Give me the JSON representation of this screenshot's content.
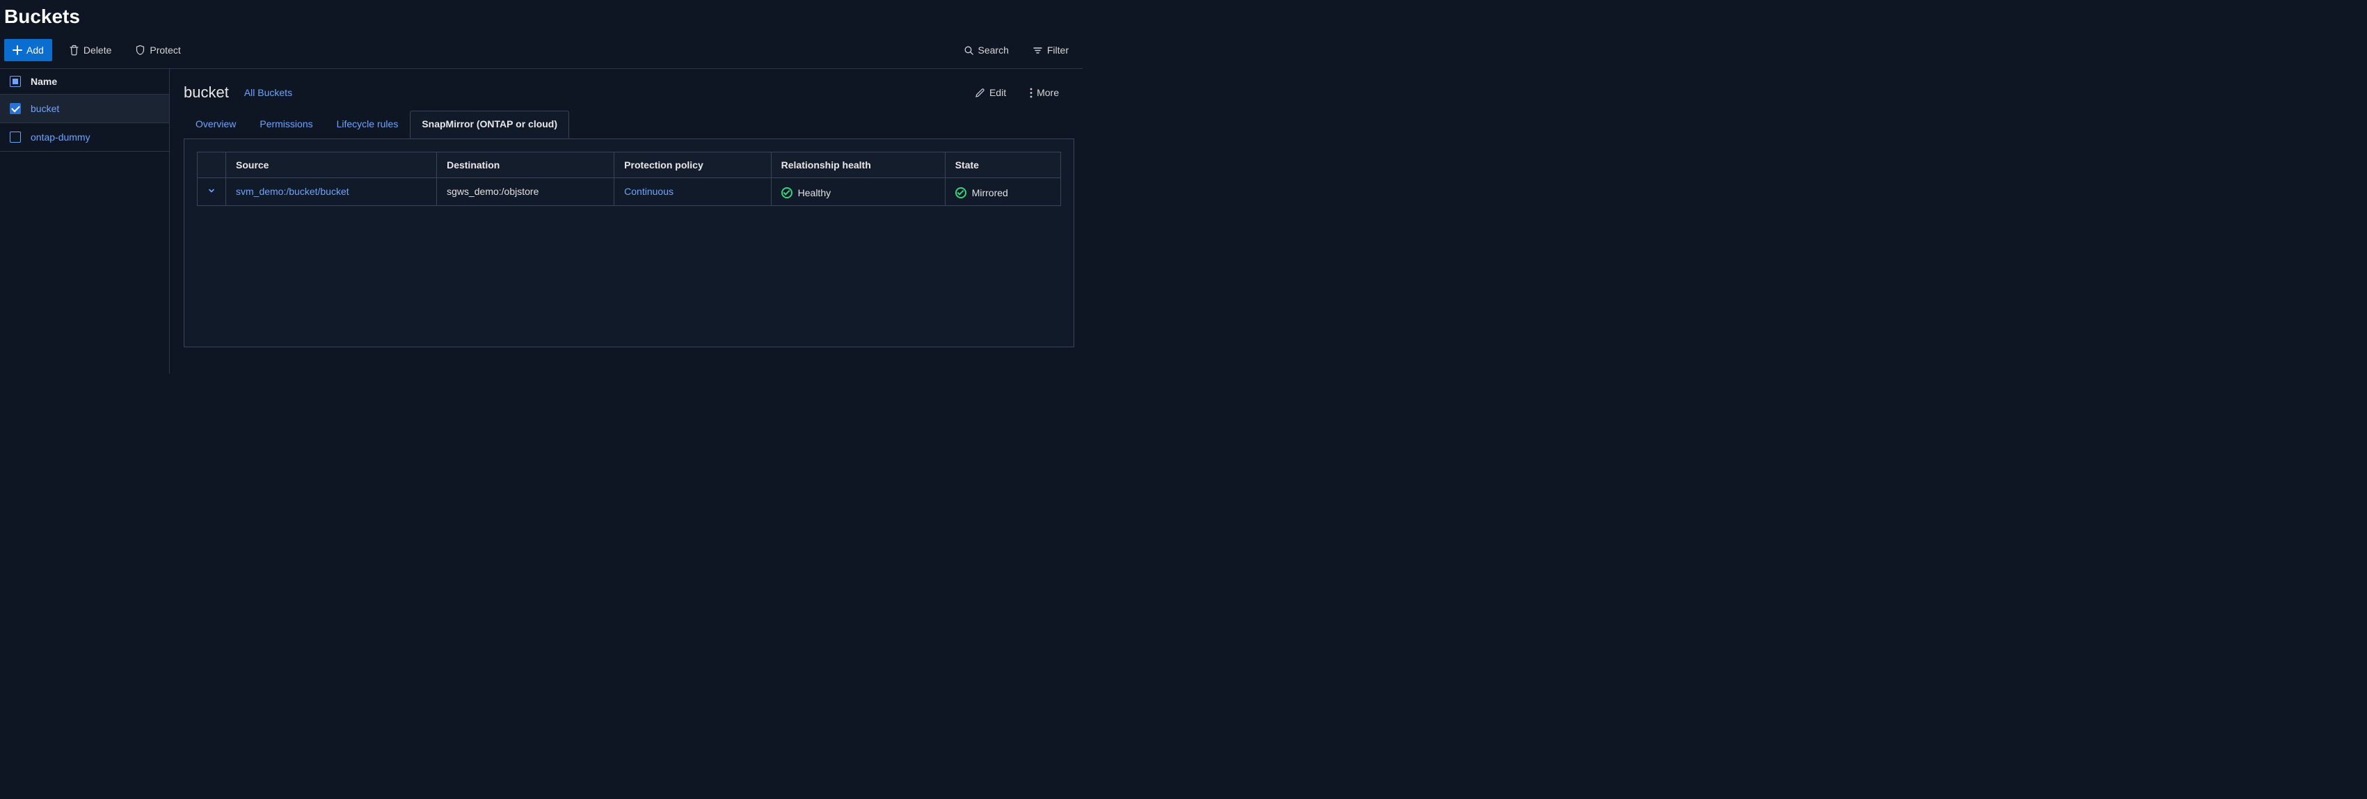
{
  "page": {
    "title": "Buckets"
  },
  "toolbar": {
    "add_label": "Add",
    "delete_label": "Delete",
    "protect_label": "Protect",
    "search_label": "Search",
    "filter_label": "Filter"
  },
  "sidebar": {
    "header": "Name",
    "items": [
      {
        "name": "bucket",
        "selected": true,
        "checked": true
      },
      {
        "name": "ontap-dummy",
        "selected": false,
        "checked": false
      }
    ]
  },
  "detail": {
    "title": "bucket",
    "breadcrumb": "All Buckets",
    "edit_label": "Edit",
    "more_label": "More",
    "tabs": [
      {
        "label": "Overview"
      },
      {
        "label": "Permissions"
      },
      {
        "label": "Lifecycle rules"
      },
      {
        "label": "SnapMirror (ONTAP or cloud)"
      }
    ],
    "active_tab": 3
  },
  "table": {
    "columns": {
      "source": "Source",
      "destination": "Destination",
      "policy": "Protection policy",
      "health": "Relationship health",
      "state": "State"
    },
    "rows": [
      {
        "source": "svm_demo:/bucket/bucket",
        "destination": "sgws_demo:/objstore",
        "policy": "Continuous",
        "health": "Healthy",
        "state": "Mirrored"
      }
    ]
  }
}
